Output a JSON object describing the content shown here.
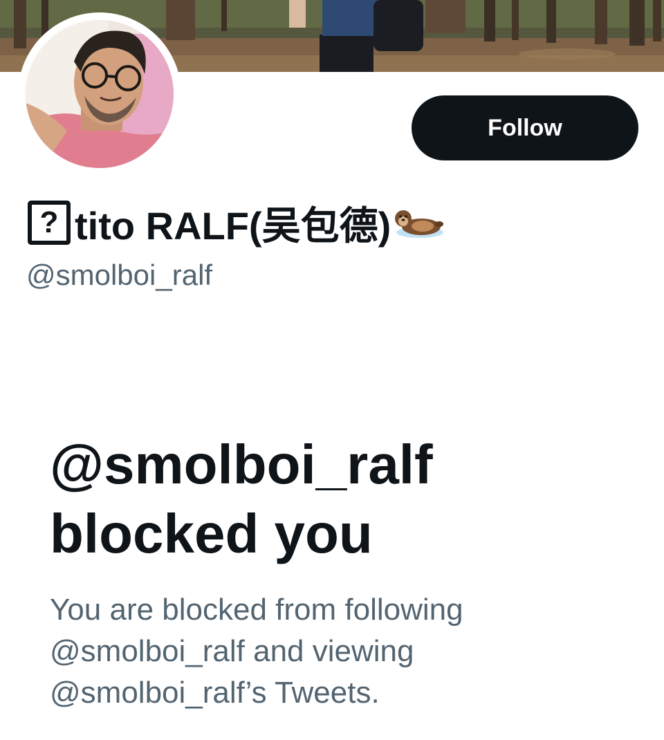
{
  "profile": {
    "display_name_text": "tito RALF(吴包德)",
    "missing_glyph_char": "?",
    "name_emoji_icon": "otter-icon",
    "handle": "@smolboi_ralf"
  },
  "actions": {
    "follow_label": "Follow"
  },
  "blocked": {
    "title_line1": "@smolboi_ralf",
    "title_line2": "blocked you",
    "description_line1": "You are blocked from following",
    "description_line2": "@smolboi_ralf and viewing",
    "description_line3": "@smolboi_ralf’s Tweets."
  },
  "colors": {
    "text_primary": "#0f1419",
    "text_secondary": "#536471",
    "button_background": "#0f1419",
    "button_text": "#ffffff",
    "background": "#ffffff"
  }
}
